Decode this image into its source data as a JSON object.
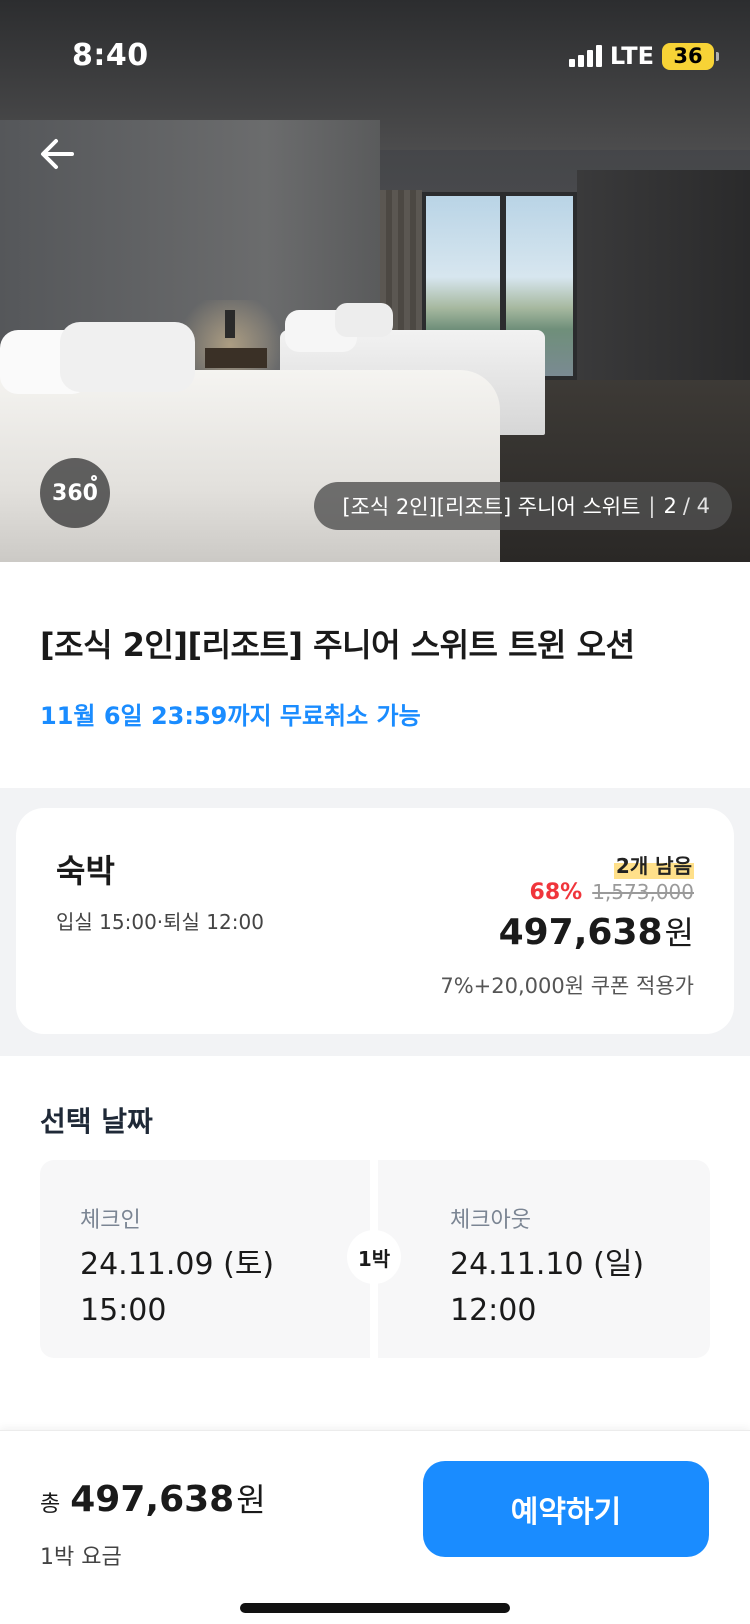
{
  "status_bar": {
    "time": "8:40",
    "network": "LTE",
    "battery": "36"
  },
  "hero": {
    "badge_360": "360",
    "caption": "[조식 2인][리조트] 주니어 스위트",
    "photo_index": "2",
    "photo_total": "4"
  },
  "room": {
    "title": "[조식 2인][리조트] 주니어 스위트 트윈 오션",
    "cancel_note": "11월 6일 23:59까지 무료취소 가능"
  },
  "offer": {
    "plan_name": "숙박",
    "check_times": "입실 15:00·퇴실 12:00",
    "stock": "2개 남음",
    "discount": "68%",
    "original_price": "1,573,000",
    "final_price": "497,638",
    "currency": "원",
    "coupon_note": "7%+20,000원 쿠폰 적용가"
  },
  "dates": {
    "section_title": "선택 날짜",
    "checkin_label": "체크인",
    "checkin_date": "24.11.09 (토)",
    "checkin_time": "15:00",
    "checkout_label": "체크아웃",
    "checkout_date": "24.11.10 (일)",
    "checkout_time": "12:00",
    "nights": "1박"
  },
  "bottom": {
    "total_prefix": "총",
    "total_price": "497,638",
    "currency": "원",
    "subtitle": "1박 요금",
    "book_label": "예약하기"
  },
  "colors": {
    "accent": "#1a8cff",
    "discount": "#f0353b",
    "stock_highlight": "#ffe08a",
    "battery": "#f7d336"
  },
  "icons": {
    "back": "arrow-left-icon",
    "signal": "signal-bars-icon",
    "battery": "battery-icon"
  }
}
